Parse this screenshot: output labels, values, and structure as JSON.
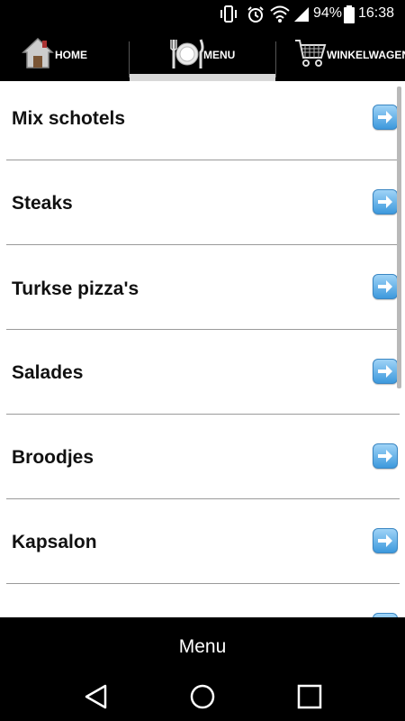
{
  "status_bar": {
    "battery_percent": "94%",
    "time": "16:38",
    "icons": [
      "vibrate-icon",
      "alarm-icon",
      "wifi-icon",
      "signal-icon",
      "battery-icon"
    ]
  },
  "topnav": {
    "tabs": [
      {
        "label": "HOME",
        "icon": "house-icon"
      },
      {
        "label": "MENU",
        "icon": "plate-cutlery-icon",
        "active": true
      },
      {
        "label": "WINKELWAGEN",
        "icon": "shopping-cart-icon"
      }
    ]
  },
  "menu_list": {
    "items": [
      {
        "label": "Mix schotels"
      },
      {
        "label": "Steaks"
      },
      {
        "label": "Turkse pizza's"
      },
      {
        "label": "Salades"
      },
      {
        "label": "Broodjes"
      },
      {
        "label": "Kapsalon"
      }
    ],
    "arrow_icon": "arrow-right-icon"
  },
  "bottom_bar": {
    "title": "Menu"
  },
  "system_nav": {
    "buttons": [
      "back-icon",
      "home-circle-icon",
      "recents-icon"
    ]
  },
  "colors": {
    "background_dark": "#000000",
    "list_background": "#ffffff",
    "arrow_accent": "#3d99dd",
    "active_tab_indicator": "#d8d8d8"
  }
}
